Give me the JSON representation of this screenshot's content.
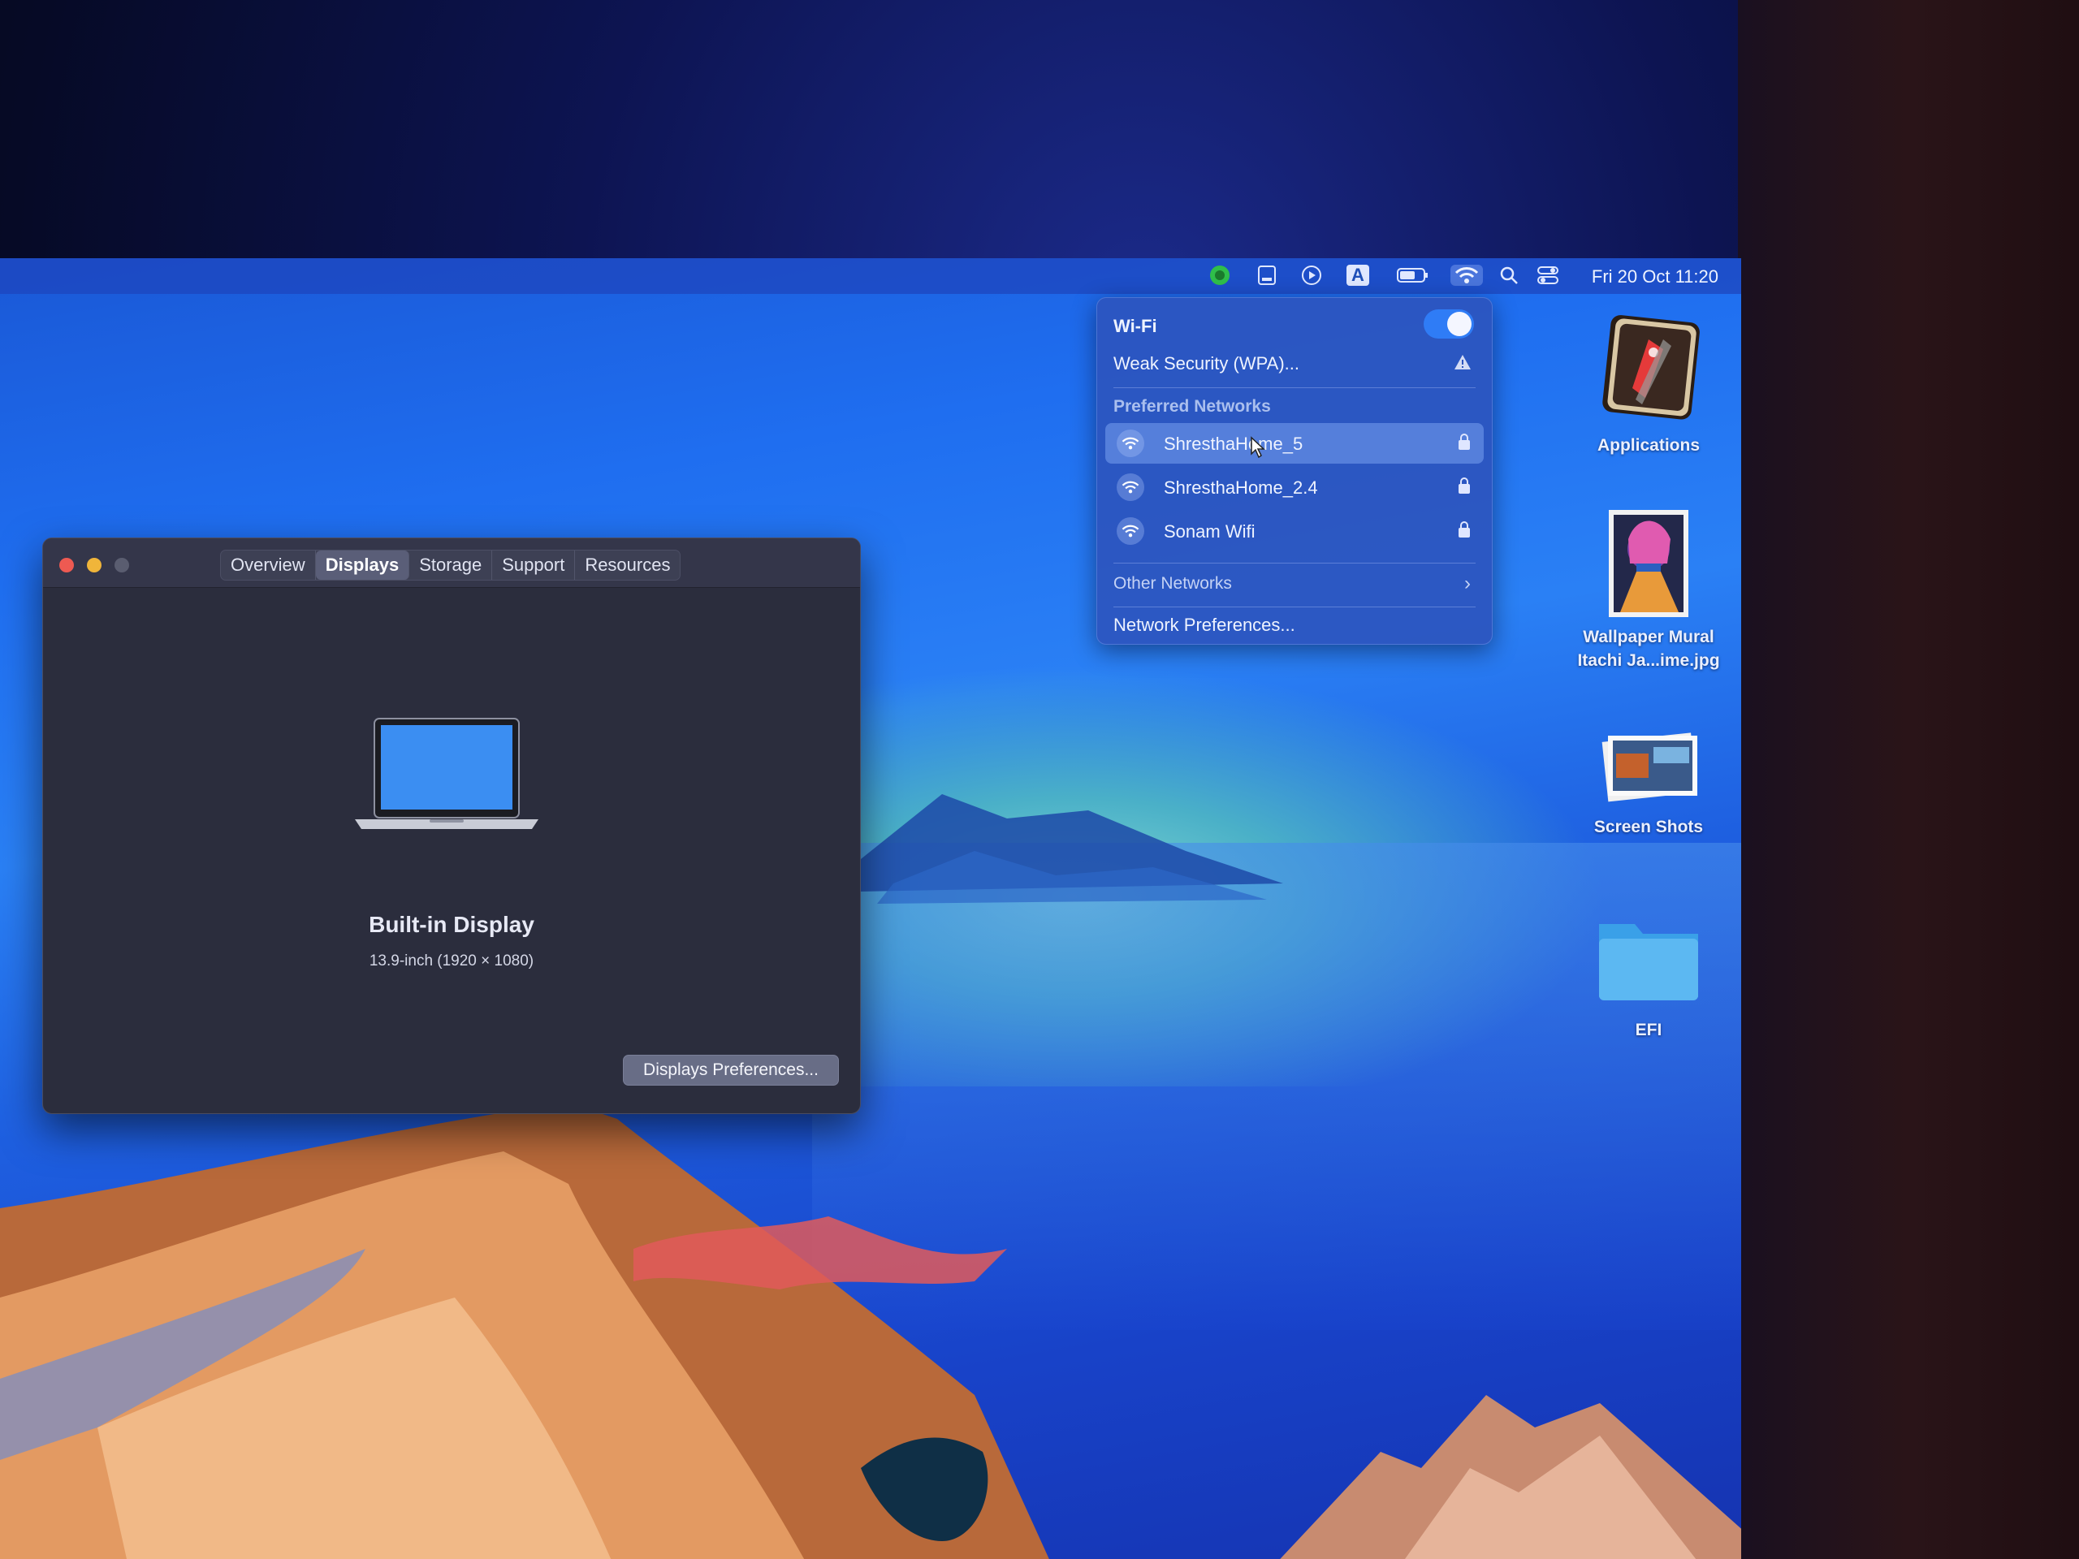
{
  "menubar": {
    "icons": [
      "status-green-icon",
      "disk-icon",
      "play-icon",
      "keyboard-input-icon",
      "battery-icon",
      "wifi-icon",
      "search-icon",
      "control-center-icon"
    ],
    "input_letter": "A",
    "clock": "Fri 20 Oct  11:20"
  },
  "wifi_menu": {
    "title": "Wi-Fi",
    "toggle_on": true,
    "current_warning": "Weak Security (WPA)...",
    "preferred_header": "Preferred Networks",
    "networks": [
      {
        "name": "ShresthaHome_5",
        "locked": true,
        "highlighted": true
      },
      {
        "name": "ShresthaHome_2.4",
        "locked": true,
        "highlighted": false
      },
      {
        "name": "Sonam Wifi",
        "locked": true,
        "highlighted": false
      }
    ],
    "other_networks": "Other Networks",
    "network_prefs": "Network Preferences..."
  },
  "about_window": {
    "tabs": [
      "Overview",
      "Displays",
      "Storage",
      "Support",
      "Resources"
    ],
    "active_tab": "Displays",
    "display_name": "Built-in Display",
    "display_spec": "13.9-inch (1920 × 1080)",
    "prefs_button": "Displays Preferences..."
  },
  "desktop_icons": [
    {
      "label_lines": [
        "Applications"
      ]
    },
    {
      "label_lines": [
        "Wallpaper Mural",
        "Itachi Ja...ime.jpg"
      ]
    },
    {
      "label_lines": [
        "Screen Shots"
      ]
    },
    {
      "label_lines": [
        "EFI"
      ]
    }
  ],
  "colors": {
    "accent": "#2f7cf6",
    "close": "#ee5a52",
    "minimize": "#f0b53a",
    "zoom": "#5a5d70"
  }
}
